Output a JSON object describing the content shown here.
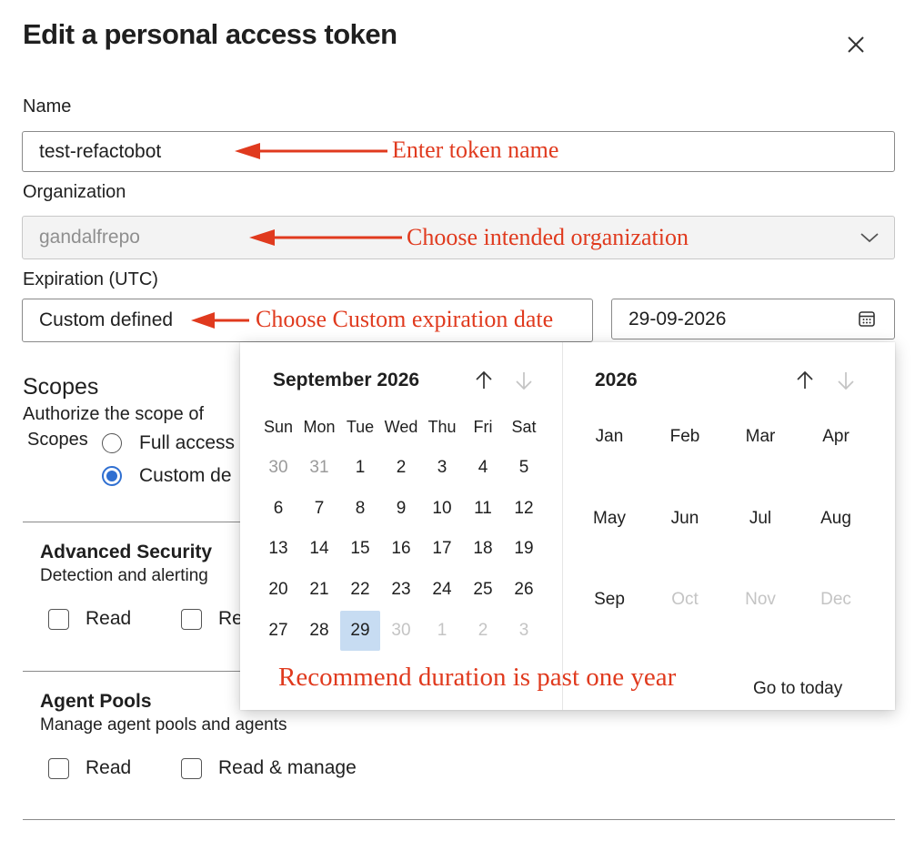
{
  "dialog": {
    "title": "Edit a personal access token",
    "close_icon": "close-icon"
  },
  "form": {
    "name_label": "Name",
    "name_value": "test-refactobot",
    "org_label": "Organization",
    "org_value": "gandalfrepo",
    "expiration_label": "Expiration (UTC)",
    "expiration_mode": "Custom defined",
    "expiration_date": "29-09-2026"
  },
  "annotations": {
    "name": "Enter token name",
    "org": "Choose intended organization",
    "expiration": "Choose Custom expiration date",
    "duration": "Recommend duration is past one year",
    "color": "#e03a1e"
  },
  "scopes": {
    "heading": "Scopes",
    "desc": "Authorize the scope of",
    "label": "Scopes",
    "options": [
      "Full access",
      "Custom de"
    ],
    "selected": "Custom de"
  },
  "sections": [
    {
      "title": "Advanced Security",
      "desc": "Detection and alerting",
      "checks": [
        "Read",
        "Re"
      ]
    },
    {
      "title": "Agent Pools",
      "desc": "Manage agent pools and agents",
      "checks": [
        "Read",
        "Read & manage"
      ]
    }
  ],
  "calendar": {
    "month_title": "September 2026",
    "weekdays": [
      "Sun",
      "Mon",
      "Tue",
      "Wed",
      "Thu",
      "Fri",
      "Sat"
    ],
    "weeks": [
      [
        "30",
        "31",
        "1",
        "2",
        "3",
        "4",
        "5"
      ],
      [
        "6",
        "7",
        "8",
        "9",
        "10",
        "11",
        "12"
      ],
      [
        "13",
        "14",
        "15",
        "16",
        "17",
        "18",
        "19"
      ],
      [
        "20",
        "21",
        "22",
        "23",
        "24",
        "25",
        "26"
      ],
      [
        "27",
        "28",
        "29",
        "30",
        "1",
        "2",
        "3"
      ]
    ],
    "selected_day": "29",
    "year_title": "2026",
    "months": [
      "Jan",
      "Feb",
      "Mar",
      "Apr",
      "May",
      "Jun",
      "Jul",
      "Aug",
      "Sep",
      "Oct",
      "Nov",
      "Dec"
    ],
    "disabled_months": [
      "Oct",
      "Nov",
      "Dec"
    ],
    "go_to_today": "Go to today",
    "selected_color": "#c7dcf2",
    "accent_color": "#2f6fd1"
  }
}
